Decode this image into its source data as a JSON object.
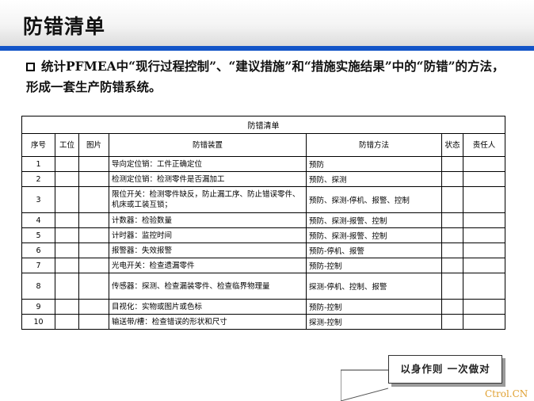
{
  "slide": {
    "title": "防错清单",
    "intro": "统计PFMEA中“现行过程控制”、“建议措施”和“措施实施结果”中的“防错”的方法，形成一套生产防错系统。"
  },
  "table": {
    "caption": "防错清单",
    "headers": {
      "no": "序号",
      "station": "工位",
      "image": "图片",
      "device": "防错装置",
      "method": "防错方法",
      "status": "状态",
      "owner": "责任人"
    },
    "rows": [
      {
        "no": "1",
        "device": "导向定位销：工件正确定位",
        "method": "预防"
      },
      {
        "no": "2",
        "device": "检测定位销：检测零件是否漏加工",
        "method": "预防、探测"
      },
      {
        "no": "3",
        "device": "限位开关：检测零件缺反，防止漏工序、防止错误零件、机床或工装互锁；",
        "method": "预防、探测-停机、报警、控制"
      },
      {
        "no": "4",
        "device": "计数器：检验数量",
        "method": "预防、探测-报警、控制"
      },
      {
        "no": "5",
        "device": "计时器：监控时间",
        "method": "预防、探测-报警、控制"
      },
      {
        "no": "6",
        "device": "报警器：失效报警",
        "method": "预防-停机、报警"
      },
      {
        "no": "7",
        "device": "光电开关：检查遗漏零件",
        "method": "预防-控制"
      },
      {
        "no": "8",
        "device": "传感器：探测、检查漏装零件、检查临界物理量",
        "method": "探测-停机、控制、报警"
      },
      {
        "no": "9",
        "device": "目视化：实物或图片或色标",
        "method": "预防-控制"
      },
      {
        "no": "10",
        "device": "输送带/槽：检查错误的形状和尺寸",
        "method": "探测-控制"
      }
    ]
  },
  "stamp": {
    "text": "以身作则  一次做对"
  },
  "watermark": "Ctrol.CN",
  "colors": {
    "accent_rule": "#1254c8",
    "watermark": "#e0a030"
  }
}
